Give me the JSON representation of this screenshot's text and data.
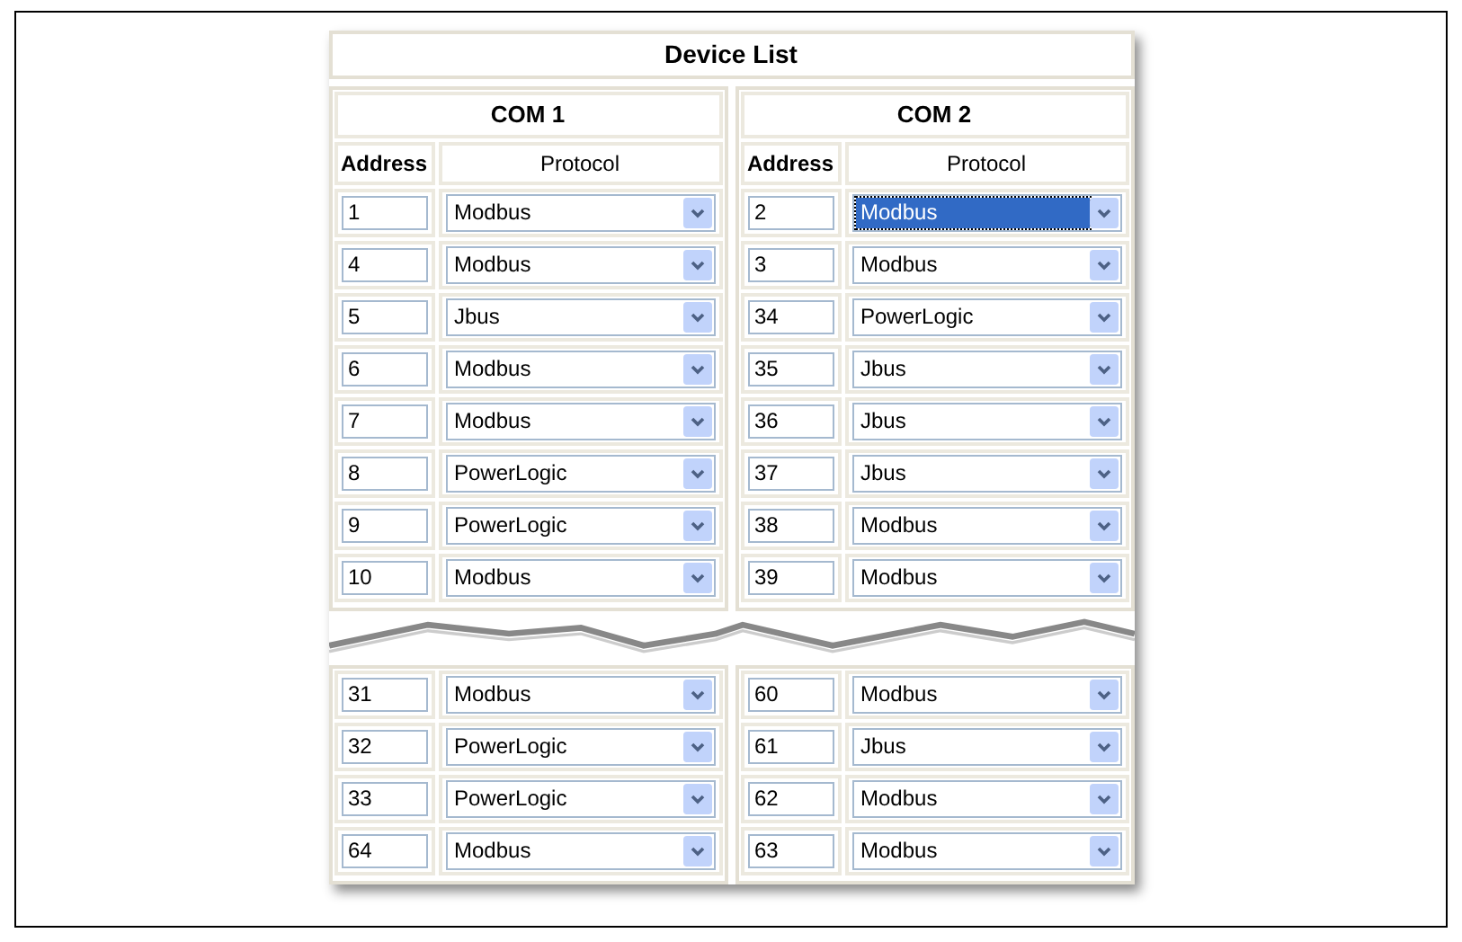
{
  "title": "Device List",
  "ports": [
    {
      "name": "COM 1",
      "columns": [
        "Address",
        "Protocol"
      ],
      "rows_before_break": [
        {
          "address": "1",
          "protocol": "Modbus",
          "focused": false
        },
        {
          "address": "4",
          "protocol": "Modbus",
          "focused": false
        },
        {
          "address": "5",
          "protocol": "Jbus",
          "focused": false
        },
        {
          "address": "6",
          "protocol": "Modbus",
          "focused": false
        },
        {
          "address": "7",
          "protocol": "Modbus",
          "focused": false
        },
        {
          "address": "8",
          "protocol": "PowerLogic",
          "focused": false
        },
        {
          "address": "9",
          "protocol": "PowerLogic",
          "focused": false
        },
        {
          "address": "10",
          "protocol": "Modbus",
          "focused": false
        }
      ],
      "rows_after_break": [
        {
          "address": "31",
          "protocol": "Modbus",
          "focused": false
        },
        {
          "address": "32",
          "protocol": "PowerLogic",
          "focused": false
        },
        {
          "address": "33",
          "protocol": "PowerLogic",
          "focused": false
        },
        {
          "address": "64",
          "protocol": "Modbus",
          "focused": false
        }
      ]
    },
    {
      "name": "COM 2",
      "columns": [
        "Address",
        "Protocol"
      ],
      "rows_before_break": [
        {
          "address": "2",
          "protocol": "Modbus",
          "focused": true
        },
        {
          "address": "3",
          "protocol": "Modbus",
          "focused": false
        },
        {
          "address": "34",
          "protocol": "PowerLogic",
          "focused": false
        },
        {
          "address": "35",
          "protocol": "Jbus",
          "focused": false
        },
        {
          "address": "36",
          "protocol": "Jbus",
          "focused": false
        },
        {
          "address": "37",
          "protocol": "Jbus",
          "focused": false
        },
        {
          "address": "38",
          "protocol": "Modbus",
          "focused": false
        },
        {
          "address": "39",
          "protocol": "Modbus",
          "focused": false
        }
      ],
      "rows_after_break": [
        {
          "address": "60",
          "protocol": "Modbus",
          "focused": false
        },
        {
          "address": "61",
          "protocol": "Jbus",
          "focused": false
        },
        {
          "address": "62",
          "protocol": "Modbus",
          "focused": false
        },
        {
          "address": "63",
          "protocol": "Modbus",
          "focused": false
        }
      ]
    }
  ]
}
